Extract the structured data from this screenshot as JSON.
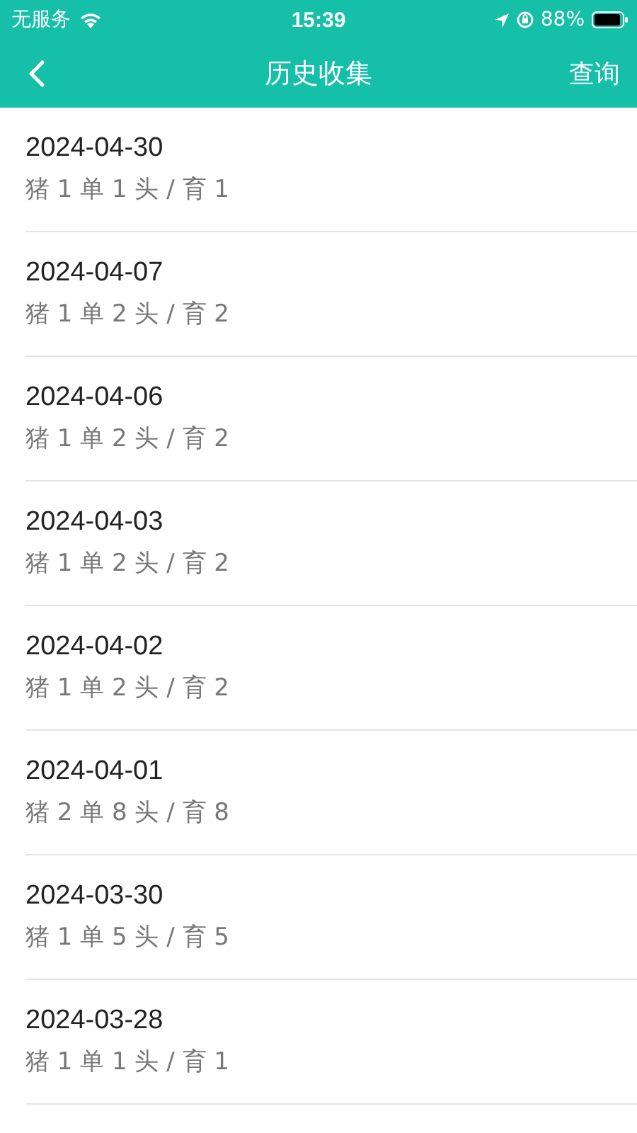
{
  "status_bar": {
    "carrier": "无服务",
    "time": "15:39",
    "battery": "88%"
  },
  "nav": {
    "title": "历史收集",
    "action": "查询"
  },
  "records": [
    {
      "date": "2024-04-30",
      "summary": "猪 1 单 1 头 / 育 1"
    },
    {
      "date": "2024-04-07",
      "summary": "猪 1 单 2 头 / 育 2"
    },
    {
      "date": "2024-04-06",
      "summary": "猪 1 单 2 头 / 育 2"
    },
    {
      "date": "2024-04-03",
      "summary": "猪 1 单 2 头 / 育 2"
    },
    {
      "date": "2024-04-02",
      "summary": "猪 1 单 2 头 / 育 2"
    },
    {
      "date": "2024-04-01",
      "summary": "猪 2 单 8 头 / 育 8"
    },
    {
      "date": "2024-03-30",
      "summary": "猪 1 单 5 头 / 育 5"
    },
    {
      "date": "2024-03-28",
      "summary": "猪 1 单 1 头 / 育 1"
    }
  ]
}
